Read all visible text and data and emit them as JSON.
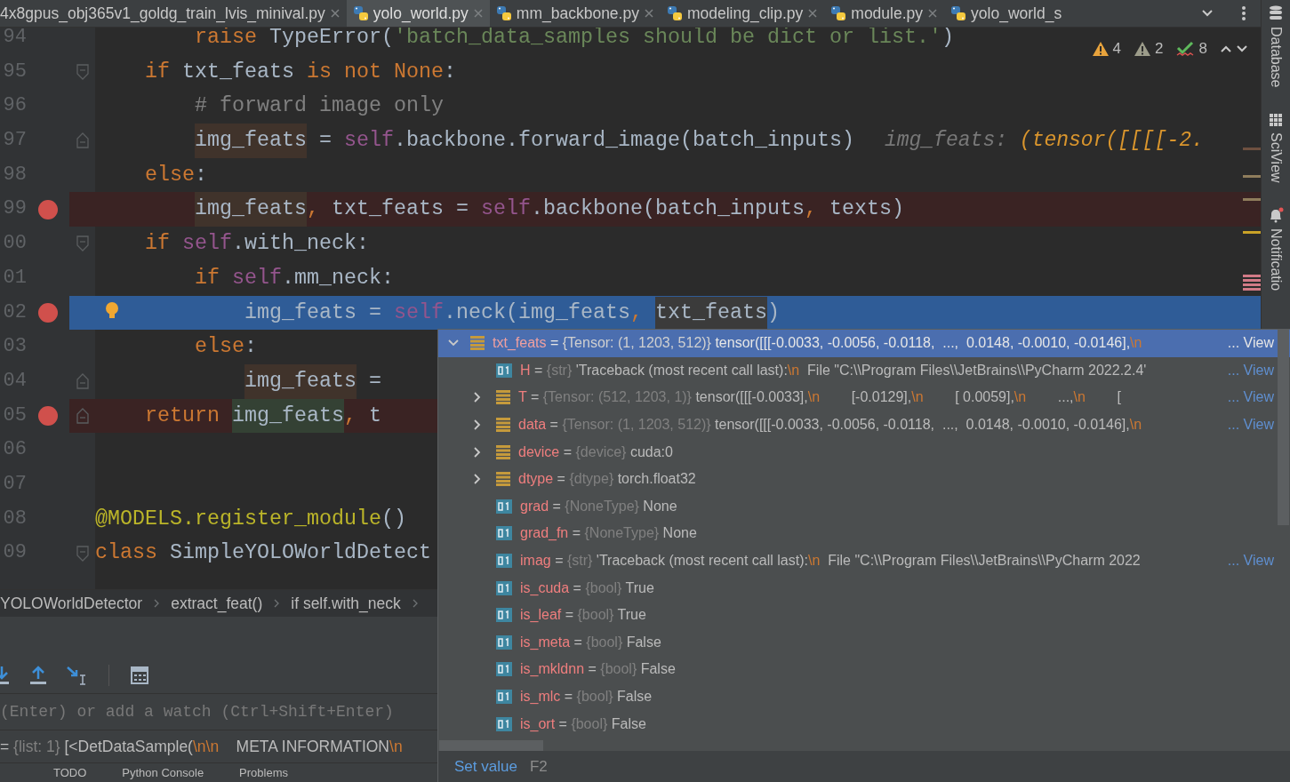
{
  "tabs": [
    {
      "label": "4x8gpus_obj365v1_goldg_train_lvis_minival.py",
      "selected": false,
      "closable": true
    },
    {
      "label": "yolo_world.py",
      "selected": true,
      "closable": true
    },
    {
      "label": "mm_backbone.py",
      "selected": false,
      "closable": true
    },
    {
      "label": "modeling_clip.py",
      "selected": false,
      "closable": true
    },
    {
      "label": "module.py",
      "selected": false,
      "closable": true
    },
    {
      "label": "yolo_world_s",
      "selected": false,
      "closable": false
    }
  ],
  "inspections": {
    "warnings": "4",
    "weak_warnings": "2",
    "typos": "8"
  },
  "code": [
    {
      "number": "94",
      "kind": "indent2",
      "breakpoint": false,
      "current": false,
      "fold_start": false,
      "fold_end": false,
      "tokens": [
        {
          "text": "raise ",
          "kind": "keyword"
        },
        {
          "text": "TypeError(",
          "kind": "plain"
        },
        {
          "text": "'batch_data_samples should be dict or list.'",
          "kind": "string"
        },
        {
          "text": ")",
          "kind": "plain"
        }
      ]
    },
    {
      "number": "95",
      "kind": "indent1",
      "breakpoint": false,
      "current": false,
      "fold_start": true,
      "fold_end": false,
      "tokens": [
        {
          "text": "if ",
          "kind": "keyword"
        },
        {
          "text": "txt_feats ",
          "kind": "plain"
        },
        {
          "text": "is not None",
          "kind": "keyword"
        },
        {
          "text": ":",
          "kind": "plain"
        }
      ]
    },
    {
      "number": "96",
      "kind": "indent2",
      "breakpoint": false,
      "current": false,
      "fold_start": false,
      "fold_end": false,
      "tokens": [
        {
          "text": "# forward image only",
          "kind": "comment"
        }
      ]
    },
    {
      "number": "97",
      "kind": "indent2",
      "breakpoint": false,
      "current": false,
      "fold_start": false,
      "fold_end": true,
      "tokens": [
        {
          "text": "img_feats",
          "kind": "write_usage"
        },
        {
          "text": " = ",
          "kind": "plain"
        },
        {
          "text": "self",
          "kind": "self"
        },
        {
          "text": ".backbone.forward_image(batch_inputs)",
          "kind": "plain"
        }
      ],
      "hint": {
        "label": "img_feats:",
        "value": "(tensor([[[[-2."
      }
    },
    {
      "number": "98",
      "kind": "indent1",
      "breakpoint": false,
      "current": false,
      "fold_start": false,
      "fold_end": false,
      "tokens": [
        {
          "text": "else",
          "kind": "keyword"
        },
        {
          "text": ":",
          "kind": "plain"
        }
      ]
    },
    {
      "number": "99",
      "kind": "indent2",
      "breakpoint": true,
      "current": false,
      "fold_start": false,
      "fold_end": false,
      "tokens": [
        {
          "text": "img_feats",
          "kind": "write_usage"
        },
        {
          "text": ", ",
          "kind": "keyword"
        },
        {
          "text": "txt_feats = ",
          "kind": "plain"
        },
        {
          "text": "self",
          "kind": "self"
        },
        {
          "text": ".backbone(batch_inputs",
          "kind": "plain"
        },
        {
          "text": ", ",
          "kind": "keyword"
        },
        {
          "text": "texts)",
          "kind": "plain"
        }
      ]
    },
    {
      "number": "00",
      "kind": "indent1",
      "breakpoint": false,
      "current": false,
      "fold_start": true,
      "fold_end": false,
      "tokens": [
        {
          "text": "if ",
          "kind": "keyword"
        },
        {
          "text": "self",
          "kind": "self"
        },
        {
          "text": ".with_neck:",
          "kind": "plain"
        }
      ]
    },
    {
      "number": "01",
      "kind": "indent2",
      "breakpoint": false,
      "current": false,
      "fold_start": false,
      "fold_end": false,
      "tokens": [
        {
          "text": "if ",
          "kind": "keyword"
        },
        {
          "text": "self",
          "kind": "self"
        },
        {
          "text": ".mm_neck:",
          "kind": "plain"
        }
      ]
    },
    {
      "number": "02",
      "kind": "indent3",
      "breakpoint": true,
      "current": true,
      "fold_start": false,
      "fold_end": false,
      "tokens": [
        {
          "text": "img_feats = ",
          "kind": "plain"
        },
        {
          "text": "self",
          "kind": "self"
        },
        {
          "text": ".neck(img_feats",
          "kind": "plain"
        },
        {
          "text": ", ",
          "kind": "keyword"
        },
        {
          "text": "txt_feats",
          "kind": "match_usage"
        },
        {
          "text": ")",
          "kind": "plain"
        }
      ]
    },
    {
      "number": "03",
      "kind": "indent2",
      "breakpoint": false,
      "current": false,
      "fold_start": false,
      "fold_end": false,
      "tokens": [
        {
          "text": "else",
          "kind": "keyword"
        },
        {
          "text": ":",
          "kind": "plain"
        }
      ]
    },
    {
      "number": "04",
      "kind": "indent3",
      "breakpoint": false,
      "current": false,
      "fold_start": false,
      "fold_end": true,
      "tokens": [
        {
          "text": "img_feats",
          "kind": "write_usage"
        },
        {
          "text": " =",
          "kind": "plain"
        }
      ]
    },
    {
      "number": "05",
      "kind": "indent1",
      "breakpoint": true,
      "current": false,
      "fold_start": false,
      "fold_end": true,
      "tokens": [
        {
          "text": "return ",
          "kind": "keyword"
        },
        {
          "text": "img_feats",
          "kind": "read_usage"
        },
        {
          "text": ", ",
          "kind": "keyword"
        },
        {
          "text": "t",
          "kind": "plain"
        }
      ]
    },
    {
      "number": "06",
      "breakpoint": false,
      "current": false,
      "fold_start": false,
      "fold_end": false
    },
    {
      "number": "07",
      "breakpoint": false,
      "current": false,
      "fold_start": false,
      "fold_end": false
    },
    {
      "number": "08",
      "kind": "top",
      "breakpoint": false,
      "current": false,
      "fold_start": false,
      "fold_end": false,
      "tokens": [
        {
          "text": "@MODELS.register_module",
          "kind": "decorator"
        },
        {
          "text": "()",
          "kind": "plain"
        }
      ]
    },
    {
      "number": "09",
      "kind": "top",
      "breakpoint": false,
      "current": false,
      "fold_start": true,
      "fold_end": false,
      "tokens": [
        {
          "text": "class ",
          "kind": "keyword"
        },
        {
          "text": "SimpleYOLOWorldDetect",
          "kind": "plain"
        }
      ]
    }
  ],
  "breadcrumb": [
    "YOLOWorldDetector",
    "extract_feat()",
    "if self.with_neck"
  ],
  "debugger": {
    "watch": {
      "placeholder": "(Enter) or add a watch (Ctrl+Shift+Enter)"
    },
    "variable": [
      {
        "text": "= ",
        "kind": "plain"
      },
      {
        "text": "{list: 1} ",
        "kind": "type"
      },
      {
        "text": "[<DetDataSample(",
        "kind": "plain"
      },
      {
        "text": "\\n\\n",
        "kind": "escape"
      },
      {
        "text": "    META INFORMATION",
        "kind": "plain"
      },
      {
        "text": "\\n",
        "kind": "escape"
      }
    ]
  },
  "tool_windows": [
    "TODO",
    "Python Console",
    "Problems"
  ],
  "side_tools": [
    "Database",
    "SciView",
    "Notificatio"
  ],
  "popup": {
    "rows": [
      {
        "name": "txt_feats",
        "op": "=",
        "type": "{Tensor: (1, 1203, 512)}",
        "kind": "object",
        "expanded": true,
        "selected": true,
        "value": [
          {
            "text": "tensor([[[-0.0033, -0.0056, -0.0118,  ...,  0.0148, -0.0010, -0.0146],",
            "kind": "plain"
          },
          {
            "text": "\\n",
            "kind": "escape"
          }
        ],
        "view": "... View",
        "children": [
          {
            "name": "H",
            "op": "=",
            "type": "{str}",
            "kind": "value",
            "selected": false,
            "value": [
              {
                "text": "'Traceback (most recent call last):",
                "kind": "plain"
              },
              {
                "text": "\\n",
                "kind": "escape"
              },
              {
                "text": "  File \"C:\\\\Program Files\\\\JetBrains\\\\PyCharm 2022.2.4'",
                "kind": "plain"
              }
            ],
            "view": "... View"
          },
          {
            "name": "T",
            "op": "=",
            "type": "{Tensor: (512, 1203, 1)}",
            "kind": "object",
            "expanded": false,
            "selected": false,
            "value": [
              {
                "text": "tensor([[[-0.0033],",
                "kind": "plain"
              },
              {
                "text": "\\n",
                "kind": "escape"
              },
              {
                "text": "        [-0.0129],",
                "kind": "plain"
              },
              {
                "text": "\\n",
                "kind": "escape"
              },
              {
                "text": "        [ 0.0059],",
                "kind": "plain"
              },
              {
                "text": "\\n",
                "kind": "escape"
              },
              {
                "text": "        ...,",
                "kind": "plain"
              },
              {
                "text": "\\n",
                "kind": "escape"
              },
              {
                "text": "        [",
                "kind": "plain"
              }
            ],
            "view": "... View"
          },
          {
            "name": "data",
            "op": "=",
            "type": "{Tensor: (1, 1203, 512)}",
            "kind": "object",
            "expanded": false,
            "selected": false,
            "value": [
              {
                "text": "tensor([[[-0.0033, -0.0056, -0.0118,  ...,  0.0148, -0.0010, -0.0146],",
                "kind": "plain"
              },
              {
                "text": "\\n",
                "kind": "escape"
              }
            ],
            "view": "... View"
          },
          {
            "name": "device",
            "op": "=",
            "type": "{device}",
            "kind": "object",
            "expanded": false,
            "selected": false,
            "value": [
              {
                "text": "cuda:0",
                "kind": "plain"
              }
            ]
          },
          {
            "name": "dtype",
            "op": "=",
            "type": "{dtype}",
            "kind": "object",
            "expanded": false,
            "selected": false,
            "value": [
              {
                "text": "torch.float32",
                "kind": "plain"
              }
            ]
          },
          {
            "name": "grad",
            "op": "=",
            "type": "{NoneType}",
            "kind": "value",
            "selected": false,
            "value": [
              {
                "text": "None",
                "kind": "plain"
              }
            ]
          },
          {
            "name": "grad_fn",
            "op": "=",
            "type": "{NoneType}",
            "kind": "value",
            "selected": false,
            "value": [
              {
                "text": "None",
                "kind": "plain"
              }
            ]
          },
          {
            "name": "imag",
            "op": "=",
            "type": "{str}",
            "kind": "value",
            "selected": false,
            "value": [
              {
                "text": "'Traceback (most recent call last):",
                "kind": "plain"
              },
              {
                "text": "\\n",
                "kind": "escape"
              },
              {
                "text": "  File \"C:\\\\Program Files\\\\JetBrains\\\\PyCharm 2022",
                "kind": "plain"
              }
            ],
            "view": "... View"
          },
          {
            "name": "is_cuda",
            "op": "=",
            "type": "{bool}",
            "kind": "value",
            "selected": false,
            "value": [
              {
                "text": "True",
                "kind": "plain"
              }
            ]
          },
          {
            "name": "is_leaf",
            "op": "=",
            "type": "{bool}",
            "kind": "value",
            "selected": false,
            "value": [
              {
                "text": "True",
                "kind": "plain"
              }
            ]
          },
          {
            "name": "is_meta",
            "op": "=",
            "type": "{bool}",
            "kind": "value",
            "selected": false,
            "value": [
              {
                "text": "False",
                "kind": "plain"
              }
            ]
          },
          {
            "name": "is_mkldnn",
            "op": "=",
            "type": "{bool}",
            "kind": "value",
            "selected": false,
            "value": [
              {
                "text": "False",
                "kind": "plain"
              }
            ]
          },
          {
            "name": "is_mlc",
            "op": "=",
            "type": "{bool}",
            "kind": "value",
            "selected": false,
            "value": [
              {
                "text": "False",
                "kind": "plain"
              }
            ]
          },
          {
            "name": "is_ort",
            "op": "=",
            "type": "{bool}",
            "kind": "value",
            "selected": false,
            "value": [
              {
                "text": "False",
                "kind": "plain"
              }
            ]
          }
        ]
      }
    ],
    "footer": {
      "action": "Set value",
      "shortcut": "F2"
    }
  }
}
